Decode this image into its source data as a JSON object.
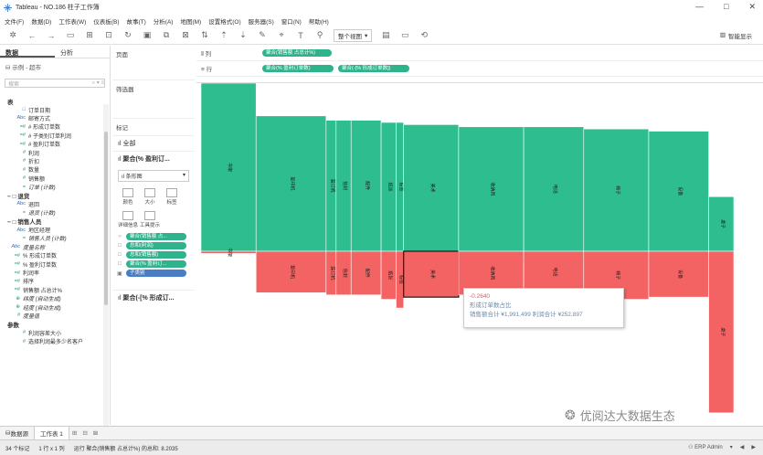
{
  "window": {
    "title": "Tableau - NO.186 柱子工作簿",
    "controls": [
      "—",
      "□",
      "✕"
    ]
  },
  "menu": [
    "文件(F)",
    "数据(D)",
    "工作表(W)",
    "仪表板(B)",
    "故事(T)",
    "分析(A)",
    "地图(M)",
    "设置格式(O)",
    "服务器(S)",
    "窗口(N)",
    "帮助(H)"
  ],
  "toolbar": {
    "view_select": "整个视图",
    "show_me": "智能显示"
  },
  "datapane": {
    "tabs": [
      "数据",
      "分析"
    ],
    "source": "示例 - 超市",
    "search_placeholder": "搜索",
    "fields": [
      {
        "label": "表",
        "kind": "header",
        "level": 0,
        "icon": ""
      },
      {
        "label": "订单日期",
        "kind": "dim",
        "level": 1,
        "icon": "□"
      },
      {
        "label": "邮寄方式",
        "kind": "dim",
        "level": 1,
        "icon": "Abc"
      },
      {
        "label": "# 形成订单数",
        "kind": "measure",
        "level": 1,
        "icon": "=#"
      },
      {
        "label": "# 子类别订单利润",
        "kind": "measure",
        "level": 1,
        "icon": "=#"
      },
      {
        "label": "# 盈利订单数",
        "kind": "measure",
        "level": 1,
        "icon": "=#"
      },
      {
        "label": "利润",
        "kind": "measure",
        "level": 1,
        "icon": "#"
      },
      {
        "label": "折扣",
        "kind": "measure",
        "level": 1,
        "icon": "#"
      },
      {
        "label": "数量",
        "kind": "measure",
        "level": 1,
        "icon": "#"
      },
      {
        "label": "销售额",
        "kind": "measure",
        "level": 1,
        "icon": "#"
      },
      {
        "label": "订单 (计数)",
        "kind": "measure-ital",
        "level": 1,
        "icon": "="
      },
      {
        "label": "− □ 退货",
        "kind": "header",
        "level": 0,
        "icon": ""
      },
      {
        "label": "退回",
        "kind": "dim",
        "level": 1,
        "icon": "Abc"
      },
      {
        "label": "退货 (计数)",
        "kind": "measure-ital",
        "level": 1,
        "icon": "="
      },
      {
        "label": "− □ 销售人员",
        "kind": "header",
        "level": 0,
        "icon": ""
      },
      {
        "label": "地区经理",
        "kind": "dim",
        "level": 1,
        "icon": "Abc"
      },
      {
        "label": "销售人员 (计数)",
        "kind": "measure-ital",
        "level": 1,
        "icon": "="
      },
      {
        "label": "度量名称",
        "kind": "dim-ital",
        "level": 0,
        "icon": "Abc"
      },
      {
        "label": "% 形成订单数",
        "kind": "measure",
        "level": 0,
        "icon": "=#"
      },
      {
        "label": "% 盈利订单数",
        "kind": "measure",
        "level": 0,
        "icon": "=#"
      },
      {
        "label": "利润率",
        "kind": "measure",
        "level": 0,
        "icon": "=#"
      },
      {
        "label": "排序",
        "kind": "measure",
        "level": 0,
        "icon": "=#"
      },
      {
        "label": "销售额 占总计%",
        "kind": "measure",
        "level": 0,
        "icon": "=#"
      },
      {
        "label": "纬度 (自动生成)",
        "kind": "measure-ital",
        "level": 0,
        "icon": "⊕"
      },
      {
        "label": "经度 (自动生成)",
        "kind": "measure-ital",
        "level": 0,
        "icon": "⊕"
      },
      {
        "label": "度量值",
        "kind": "measure-ital",
        "level": 0,
        "icon": "#"
      },
      {
        "label": "参数",
        "kind": "header",
        "level": 0,
        "icon": ""
      },
      {
        "label": "利润容差大小",
        "kind": "measure",
        "level": 1,
        "icon": "#"
      },
      {
        "label": "选择利润最多少名客户",
        "kind": "measure",
        "level": 1,
        "icon": "#"
      }
    ]
  },
  "midpane": {
    "pages_title": "页面",
    "filters_title": "筛选器",
    "marks_title": "标记",
    "all_card": "全部",
    "card1": "聚合(% 盈利订...",
    "card2": "聚合(-[% 形成订...",
    "mark_type": "条形图",
    "buttons": [
      "颜色",
      "大小",
      "标签",
      "详细信息",
      "工具提示"
    ],
    "mark_pills": [
      {
        "icon": "○",
        "label": "聚合(销售额 占...",
        "color": "green"
      },
      {
        "icon": "□",
        "label": "总和(利润)",
        "color": "green"
      },
      {
        "icon": "□",
        "label": "总和(销售额)",
        "color": "green"
      },
      {
        "icon": "□",
        "label": "聚合(% 盈利订...",
        "color": "green"
      },
      {
        "icon": "▣",
        "label": "子类别",
        "color": "blue"
      }
    ]
  },
  "shelves": {
    "columns_label": "列",
    "rows_label": "行",
    "column_pills": [
      "聚合(销售额 占总计%)"
    ],
    "row_pills": [
      "聚合(% 盈利订单数)",
      "聚合(-[% 形成订单数])"
    ]
  },
  "colors": {
    "positive": "#2ebd8f",
    "negative": "#f36363",
    "tableau_green": "#2fb38c",
    "border": "#1a1a1a"
  },
  "chart_data": {
    "type": "bar",
    "note_type": "variable-width bar (marimekko-style) with positive and negative values",
    "categories": [
      "书架",
      "复印机",
      "装订机",
      "信封",
      "配件",
      "纸张",
      "标签",
      "美术",
      "收纳具",
      "电话",
      "椅子",
      "设备",
      "桌子"
    ],
    "series": [
      {
        "name": "聚合(% 盈利订单数)",
        "values": [
          0.77,
          0.62,
          0.6,
          0.6,
          0.6,
          0.59,
          0.59,
          0.58,
          0.57,
          0.57,
          0.56,
          0.55,
          0.25
        ]
      },
      {
        "name": "聚合(-[% 形成订单数])",
        "values": [
          -0.01,
          -0.19,
          -0.2,
          -0.2,
          -0.2,
          -0.22,
          -0.26,
          -0.21,
          -0.2,
          -0.19,
          -0.22,
          -0.21,
          -0.74
        ]
      }
    ],
    "widths_share_of_sales": [
      0.11,
      0.14,
      0.02,
      0.03,
      0.06,
      0.03,
      0.015,
      0.11,
      0.13,
      0.12,
      0.13,
      0.12,
      0.05
    ],
    "tooltip": {
      "value": "-0.2640",
      "line1": "形成订单数占比",
      "line2": "销售额合计 ¥1,991,499 利润合计 ¥252,897"
    }
  },
  "watermark": "优阅达大数据生态",
  "sheettabs": {
    "datasource": "数据源",
    "sheet": "工作表 1"
  },
  "statusbar": {
    "left": [
      "34 个标记",
      "1 行 x 1 列",
      "运行 聚合(销售额 占总计%) 的总和: 8.2035"
    ],
    "right": [
      "ERP Admin",
      "▾",
      "◀",
      "▶"
    ]
  }
}
